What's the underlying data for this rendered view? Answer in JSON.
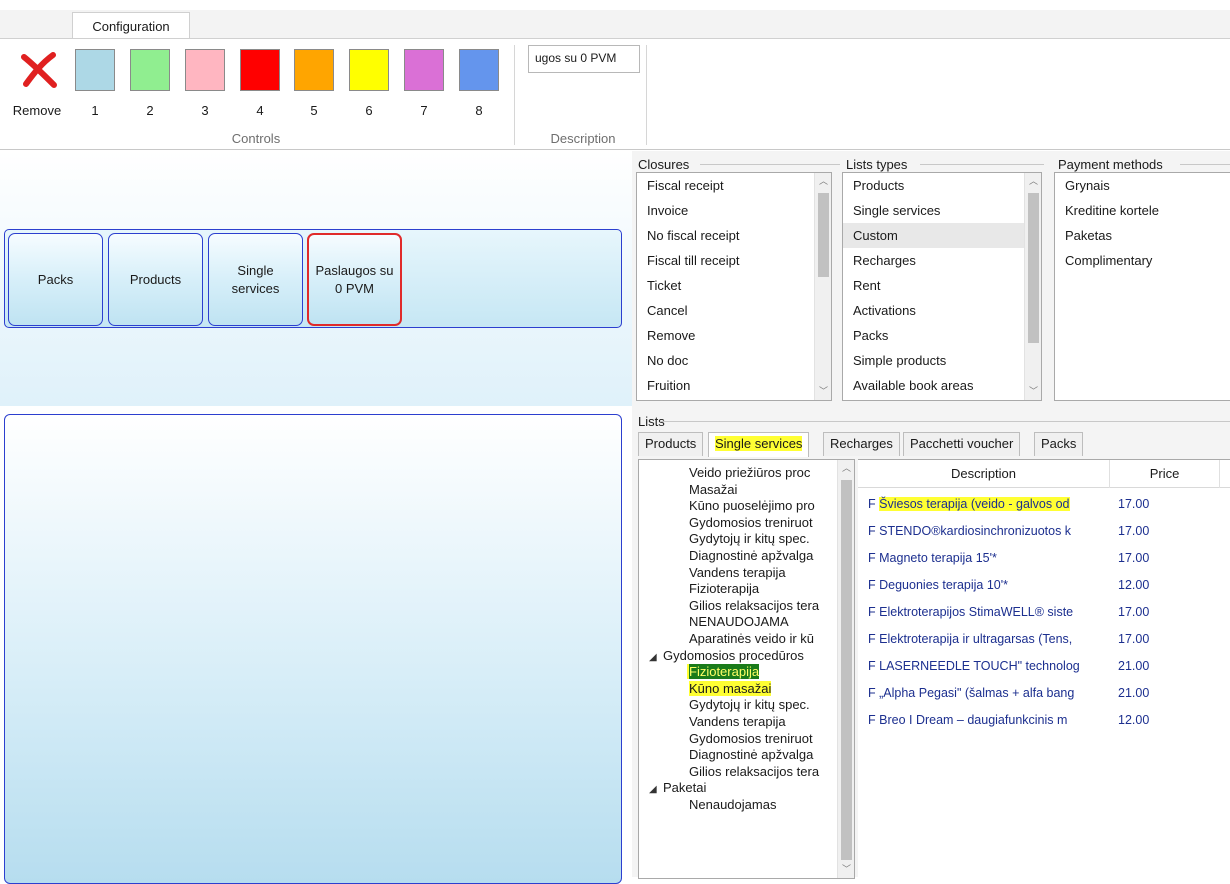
{
  "ribbon": {
    "tab_label": "Configuration",
    "remove_label": "Remove",
    "swatches": [
      {
        "num": "1",
        "color": "#add8e6"
      },
      {
        "num": "2",
        "color": "#90ee90"
      },
      {
        "num": "3",
        "color": "#ffb6c1"
      },
      {
        "num": "4",
        "color": "#ff0000"
      },
      {
        "num": "5",
        "color": "#ffa500"
      },
      {
        "num": "6",
        "color": "#ffff00"
      },
      {
        "num": "7",
        "color": "#da70d6"
      },
      {
        "num": "8",
        "color": "#6495ed"
      }
    ],
    "controls_group": "Controls",
    "description_value": "ugos su 0 PVM",
    "description_group": "Description"
  },
  "tiles": [
    {
      "label": "Packs"
    },
    {
      "label": "Products"
    },
    {
      "label": "Single\nservices"
    },
    {
      "label": "Paslaugos su\n0 PVM"
    }
  ],
  "closures": {
    "title": "Closures",
    "items": [
      "Fiscal receipt",
      "Invoice",
      "No fiscal receipt",
      "Fiscal till receipt",
      "Ticket",
      "Cancel",
      "Remove",
      "No doc",
      "Fruition"
    ]
  },
  "list_types": {
    "title": "Lists types",
    "items": [
      "Products",
      "Single services",
      "Custom",
      "Recharges",
      "Rent",
      "Activations",
      "Packs",
      "Simple products",
      "Available book areas"
    ],
    "selected": "Custom"
  },
  "payment_methods": {
    "title": "Payment methods",
    "items": [
      "Grynais",
      "Kreditine kortele",
      "Paketas",
      "Complimentary"
    ]
  },
  "lists": {
    "title": "Lists",
    "tabs": [
      "Products",
      "Single services",
      "Recharges",
      "Pacchetti voucher",
      "Packs"
    ],
    "active_tab": "Single services"
  },
  "tree": {
    "nodes": [
      {
        "level": 2,
        "text": "Veido priežiūros proc"
      },
      {
        "level": 2,
        "text": "Masažai"
      },
      {
        "level": 2,
        "text": "Kūno puoselėjimo pro"
      },
      {
        "level": 2,
        "text": "Gydomosios treniruot"
      },
      {
        "level": 2,
        "text": "Gydytojų ir kitų spec."
      },
      {
        "level": 2,
        "text": "Diagnostinė apžvalga"
      },
      {
        "level": 2,
        "text": "Vandens terapija"
      },
      {
        "level": 2,
        "text": "Fizioterapija"
      },
      {
        "level": 2,
        "text": "Gilios relaksacijos tera"
      },
      {
        "level": 2,
        "text": "NENAUDOJAMA"
      },
      {
        "level": 2,
        "text": "Aparatinės veido ir kū"
      },
      {
        "level": 1,
        "text": "Gydomosios procedūros"
      },
      {
        "level": 2,
        "text": "Fizioterapija",
        "selected": true
      },
      {
        "level": 2,
        "text": "Kūno masažai",
        "highlight": true
      },
      {
        "level": 2,
        "text": "Gydytojų ir kitų spec."
      },
      {
        "level": 2,
        "text": "Vandens terapija"
      },
      {
        "level": 2,
        "text": "Gydomosios treniruot"
      },
      {
        "level": 2,
        "text": "Diagnostinė apžvalga"
      },
      {
        "level": 2,
        "text": "Gilios relaksacijos tera"
      },
      {
        "level": 1,
        "text": "Paketai"
      },
      {
        "level": 2,
        "text": "Nenaudojamas"
      }
    ]
  },
  "grid": {
    "col_description": "Description",
    "col_price": "Price",
    "rows": [
      {
        "prefix": "F",
        "desc": "Šviesos terapija (veido - galvos od",
        "price": "17.00",
        "highlight": true
      },
      {
        "prefix": "F",
        "desc": "STENDO®kardiosinchronizuotos k",
        "price": "17.00"
      },
      {
        "prefix": "F",
        "desc": "Magneto terapija 15'*",
        "price": "17.00"
      },
      {
        "prefix": "F",
        "desc": "Deguonies terapija 10'*",
        "price": "12.00"
      },
      {
        "prefix": "F",
        "desc": "Elektroterapijos StimaWELL® siste",
        "price": "17.00"
      },
      {
        "prefix": "F",
        "desc": "Elektroterapija ir ultragarsas (Tens,",
        "price": "17.00"
      },
      {
        "prefix": "F",
        "desc": "LASERNEEDLE TOUCH\" technolog",
        "price": "21.00"
      },
      {
        "prefix": "F",
        "desc": "„Alpha Pegasi\" (šalmas + alfa bang",
        "price": "21.00"
      },
      {
        "prefix": "F",
        "desc": "Breo I Dream – daugiafunkcinis m",
        "price": "12.00"
      }
    ]
  }
}
